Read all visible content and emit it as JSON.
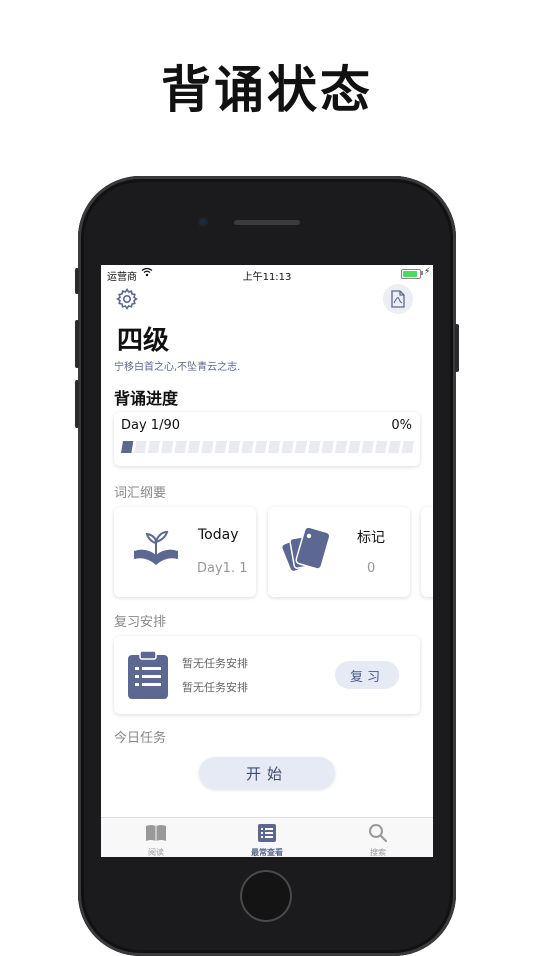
{
  "promo": {
    "title": "背诵状态"
  },
  "status_bar": {
    "carrier": "运营商",
    "time": "上午11:13",
    "battery_level": 0.9
  },
  "header": {
    "title": "四级",
    "motto": "宁移白首之心,不坠青云之志."
  },
  "progress": {
    "section_title": "背诵进度",
    "day_label": "Day 1/90",
    "percent_label": "0%",
    "value": 0
  },
  "vocab": {
    "section_title": "词汇纲要",
    "cards": [
      {
        "label": "Today",
        "value": "Day1. 1",
        "icon": "seedling-book-icon"
      },
      {
        "label": "标记",
        "value": "0",
        "icon": "tags-icon"
      }
    ]
  },
  "review": {
    "section_title": "复习安排",
    "line1": "暂无任务安排",
    "line2": "暂无任务安排",
    "button_label": "复习",
    "icon": "clipboard-list-icon"
  },
  "today": {
    "section_title": "今日任务",
    "start_label": "开始"
  },
  "tabs": [
    {
      "label": "阅读",
      "icon": "book-open-icon",
      "active": false
    },
    {
      "label": "最常查看",
      "icon": "list-icon",
      "active": true
    },
    {
      "label": "搜索",
      "icon": "search-icon",
      "active": false
    }
  ],
  "colors": {
    "accent": "#5c6891",
    "button_bg": "#e6eaf4"
  }
}
